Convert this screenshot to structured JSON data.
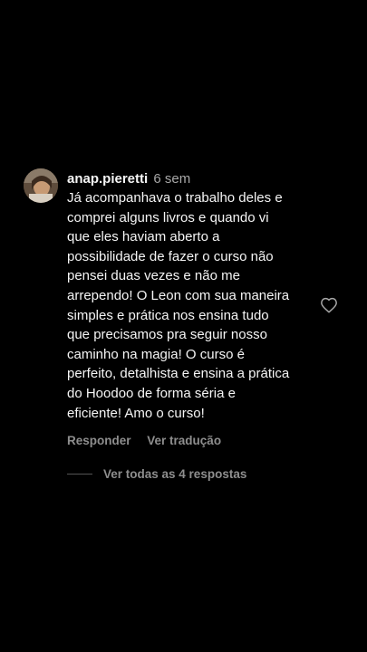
{
  "comment": {
    "username": "anap.pieretti",
    "time_ago": "6 sem",
    "lines": [
      "Já acompanhava o trabalho deles e",
      "comprei alguns livros e quando vi",
      "que eles haviam aberto a",
      "possibilidade de fazer o curso não",
      "pensei duas vezes e não me",
      "arrependo! O Leon com sua maneira",
      "simples e prática nos ensina tudo",
      "que precisamos pra seguir nosso",
      "caminho na magia! O curso é",
      "perfeito, detalhista e ensina a prática",
      "do Hoodoo de forma séria e",
      "eficiente! Amo o curso!"
    ],
    "reply_label": "Responder",
    "translate_label": "Ver tradução",
    "like_icon": "heart-outline-icon"
  },
  "replies": {
    "view_all_label": "Ver todas as 4 respostas"
  },
  "colors": {
    "background": "#000000",
    "primary_text": "#f5f5f5",
    "secondary_text": "#8e8e8e"
  }
}
